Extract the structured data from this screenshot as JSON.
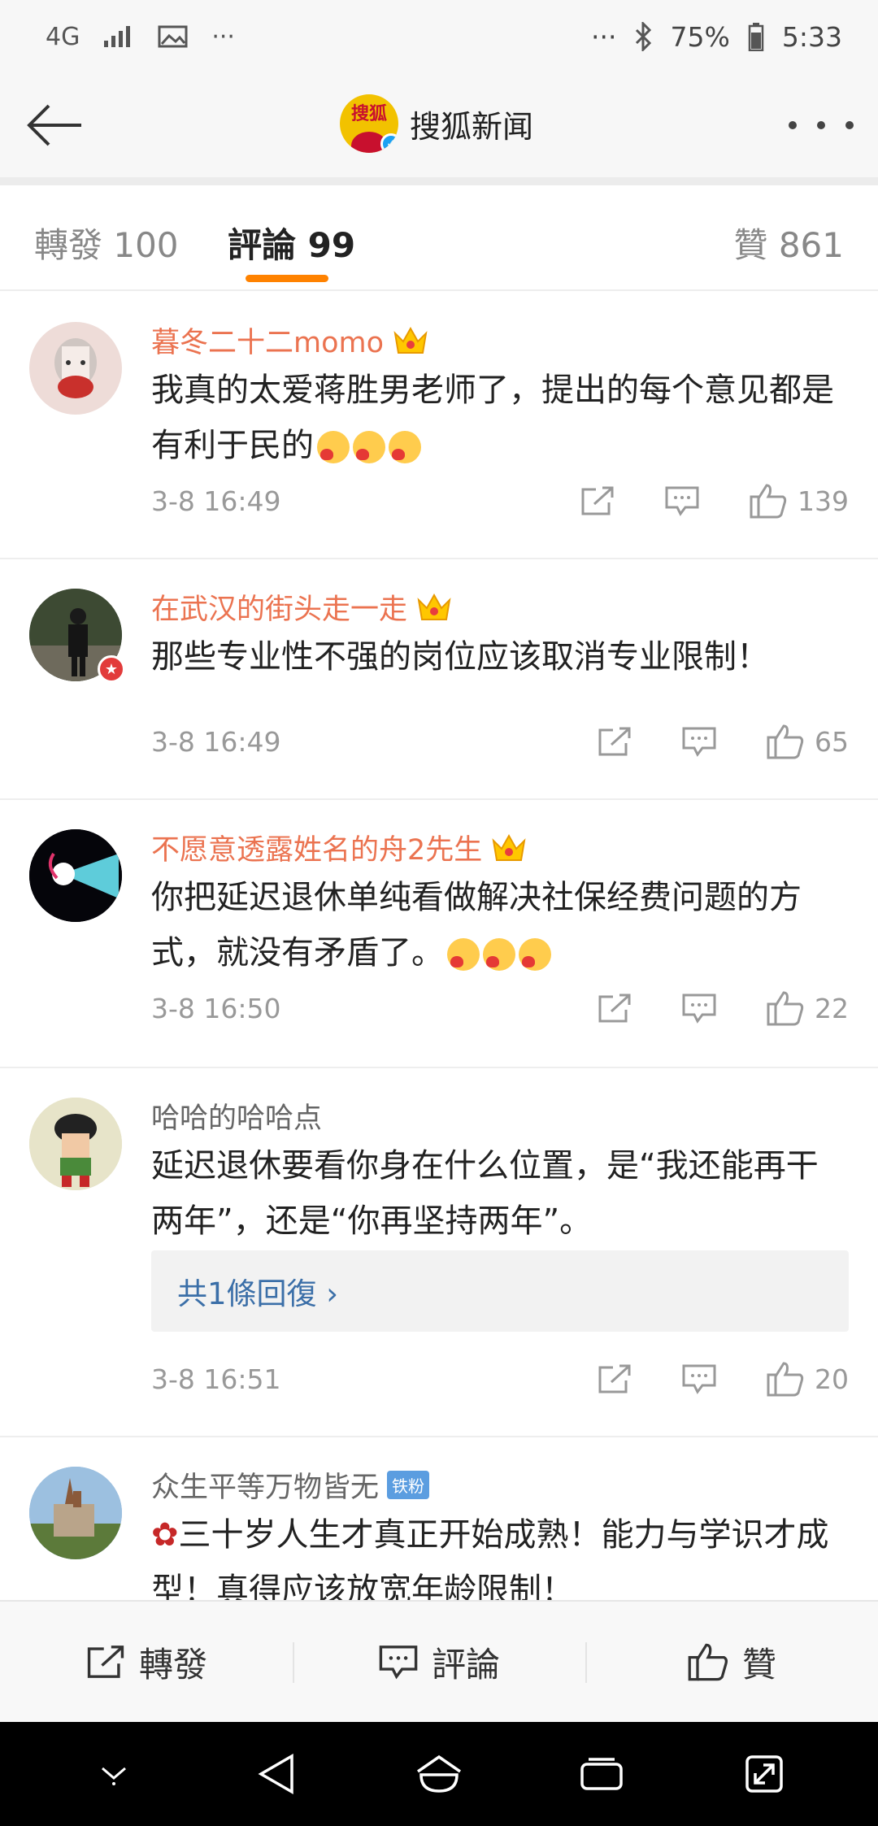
{
  "status_bar": {
    "network": "4G",
    "more_left": "···",
    "more_right": "···",
    "battery": "75%",
    "time": "5:33"
  },
  "header": {
    "title": "搜狐新闻",
    "logo_text": "搜狐"
  },
  "tabs": [
    {
      "label": "轉發 100"
    },
    {
      "label": "評論 99"
    },
    {
      "label": "贊 861"
    }
  ],
  "comments": [
    {
      "name": "暮冬二十二momo",
      "text": "我真的太爱蒋胜男老师了，提出的每个意见都是有利于民的",
      "time": "3-8 16:49",
      "likes": "139"
    },
    {
      "name": "在武汉的街头走一走",
      "text": "那些专业性不强的岗位应该取消专业限制！",
      "time": "3-8 16:49",
      "likes": "65"
    },
    {
      "name": "不愿意透露姓名的舟2先生",
      "text": "你把延迟退休单纯看做解决社保经费问题的方式，就没有矛盾了。",
      "time": "3-8 16:50",
      "likes": "22"
    },
    {
      "name": "哈哈的哈哈点",
      "text": "延迟退休要看你身在什么位置，是“我还能再干两年”，还是“你再坚持两年”。",
      "replies": "共1條回復 ›",
      "time": "3-8 16:51",
      "likes": "20"
    },
    {
      "name": "众生平等万物皆无",
      "badge": "铁粉",
      "text": "三十岁人生才真正开始成熟！能力与学识才成型！真得应该放宽年龄限制！"
    }
  ],
  "bottom_bar": {
    "repost": "轉發",
    "comment": "評論",
    "like": "贊"
  },
  "colors": {
    "accent": "#ff8200",
    "vip_name": "#eb7350",
    "link": "#3b6fa8"
  }
}
